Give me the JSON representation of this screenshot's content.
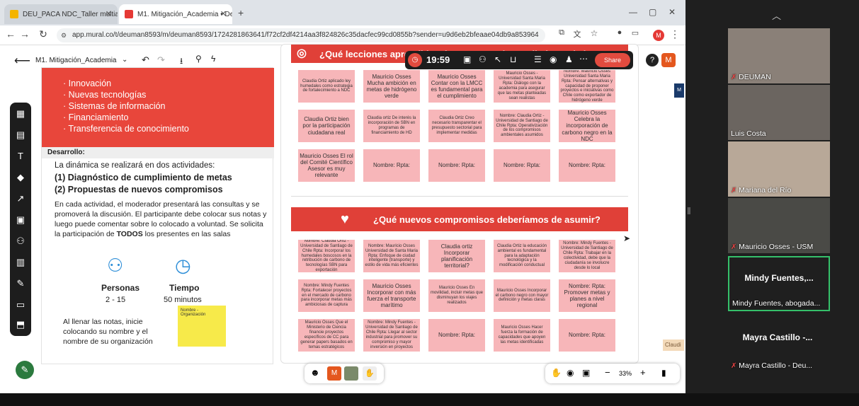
{
  "browser": {
    "tabs": [
      {
        "label": "DEU_PACA NDC_Taller multiact",
        "fav_color": "#f4b400"
      },
      {
        "label": "M1. Mitigación_Academia • Dе",
        "fav_color": "#e53935"
      }
    ],
    "new_tab": "+",
    "url": "app.mural.co/t/deuman8593/m/deuman8593/1724281863641/f72cf2df4214aa3f824826c35dacfec99cd0855b?sender=u9d6eb2bfeaae04db9a853964"
  },
  "mural": {
    "board_title": "M1. Mitigación_Academia",
    "timer": "19:59",
    "share_label": "Share",
    "avatar_letter": "M",
    "zoom_level": "33%"
  },
  "panel": {
    "bullets": [
      "Innovación",
      "Nuevas tecnologías",
      "Sistemas de información",
      "Financiamiento",
      "Transferencia de conocimiento"
    ],
    "desarrollo_label": "Desarrollo:",
    "intro": "La dinámica se realizará en dos actividades:",
    "activity1": "(1) Diagnóstico de cumplimiento de metas",
    "activity2": "(2) Propuestas de nuevos compromisos",
    "paragraph_a": "En cada actividad, el moderador presentará las consultas y se promoverá la discusión. El participante debe colocar sus notas y luego puede comentar sobre lo colocado a voluntad. Se solicita la participación de ",
    "paragraph_bold": "TODOS",
    "paragraph_b": " los presentes en las salas",
    "personas_label": "Personas",
    "personas_value": "2 - 15",
    "tiempo_label": "Tiempo",
    "tiempo_value": "50 minutos",
    "instruction": "Al llenar las notas, inicie colocando su nombre y el nombre de su organización",
    "sticky_text": "Nombre - Organización"
  },
  "canvas": {
    "banner1": "¿Qué lecciones aprendidas destacan en el cumplimiento de la meta país de",
    "banner2": "¿Qué nuevos compromisos deberíamos de asumir?",
    "notes1": [
      "Claudia Ortiz aplicado ley humedales como estrategia de fortalecimiento a NDC",
      "Mauricio Osses Mucha ambición en metas de hidrógeno verde",
      "Mauricio Osses Contar con la LMCC es fundamental para el cumplimiento",
      "Mauricio Osses - Universidad Santa Maria Rpta: Diálogo con la academia para asegurar que las metas planteadas sean realistas",
      "Nombre: Mauricio Osses Universidad Santa Maria Rpta: Pensar alternativas y capacidad de proponer proyectos e iniciativas como Chile como exportador de hidrógeno verde",
      "Claudia Ortiz bien por la participación ciudadana real",
      "Claudia ortiz De interés la incorporación de SBN en programas de financiamiento de HD",
      "Claudia Ortiz Creo necesario transparentar el presupuesto sectorial para implementar medidas",
      "Nombre: Claudia Ortiz - Universidad de Santiago de Chile Rpta: Operativización de los compromisos ambientales asumidos",
      "Mauricio Osses Celebra la incorporación de carbono negro en la NDC",
      "Mauricio Osses El rol del Comité Científico Asesor es muy relevante",
      "Nombre: Rpta:",
      "Nombre: Rpta:",
      "Nombre: Rpta:",
      "Nombre: Rpta:"
    ],
    "notes2": [
      "Nombre: Claudia Ortiz - Universidad de Santiago de Chile Rpta: Incorporar los humedales boscosos en la retribución de carbono de tecnologías SBN para exportación",
      "Nombre: Mauricio Osses Universidad de Santa Maria Rpta: Enfoque de ciudad inteligente (transporte) y estilo de vida más eficientes",
      "Claudia ortiz Incorporar planificación territorial?",
      "Claudia Ortiz la educación ambiental es fundamental para la adaptación tecnológica y la modificación conductual",
      "Nombre: Mindy Fuentes - Universidad de Santiago de Chile Rpta: Trabajar en la colectividad, debe que la ciudadanía se involucre desde lo local",
      "Nombre: Mindy Fuentes Rpta: Fortalecer proyectos en el mercado de carbono para incorporar metas más ambiciosas de captura",
      "Mauricio Osses Incorporar con más fuerza el transporte marítimo",
      "Mauricio Osses En movilidad, incluir metas que disminuyan los viajes realizados",
      "Mauricio Osses Incorporar el carbono negro con mayor definición y metas claras",
      "Nombre: Rpta: Promover metas y planes a nivel regional",
      "Mauricio Osses Que el Ministerio de Ciencia financie proyectos específicos de CC para generar papers basados en temas estratégicos",
      "Nombre: Mindy Fuentes - Universidad de Santiago de Chile Rpta: Llegar al sector industrial para promover su compromiso y mayor inversión en proyectos",
      "Nombre: Rpta:",
      "Mauricio Osses Hacer fuerza la formación de capacidades que apoyen las metas identificadas",
      "Nombre: Rpta:"
    ],
    "collab_tag": "Claudi"
  },
  "video": {
    "participants": [
      {
        "name": "DEUMAN",
        "muted": true,
        "bg": "#8a8078"
      },
      {
        "name": "Luis Costa",
        "muted": false,
        "bg": "#6b6560"
      },
      {
        "name": "Mariana del Río",
        "muted": true,
        "bg": "#b8a898"
      },
      {
        "name": "Mauricio Osses - USM",
        "muted": true,
        "bg": "#4a4a46"
      },
      {
        "name": "Mindy Fuentes,...",
        "sub": "Mindy Fuentes, abogada...",
        "muted": false,
        "bg": "#1f1f1f"
      },
      {
        "name": "Mayra Castillo -...",
        "sub": "Mayra Castillo - Deu...",
        "muted": true,
        "bg": "#1f1f1f"
      }
    ]
  },
  "colors": {
    "accent": "#e04038",
    "note": "#f7b6b9",
    "sticky": "#f7ea4a",
    "active_border": "#35c06a"
  }
}
